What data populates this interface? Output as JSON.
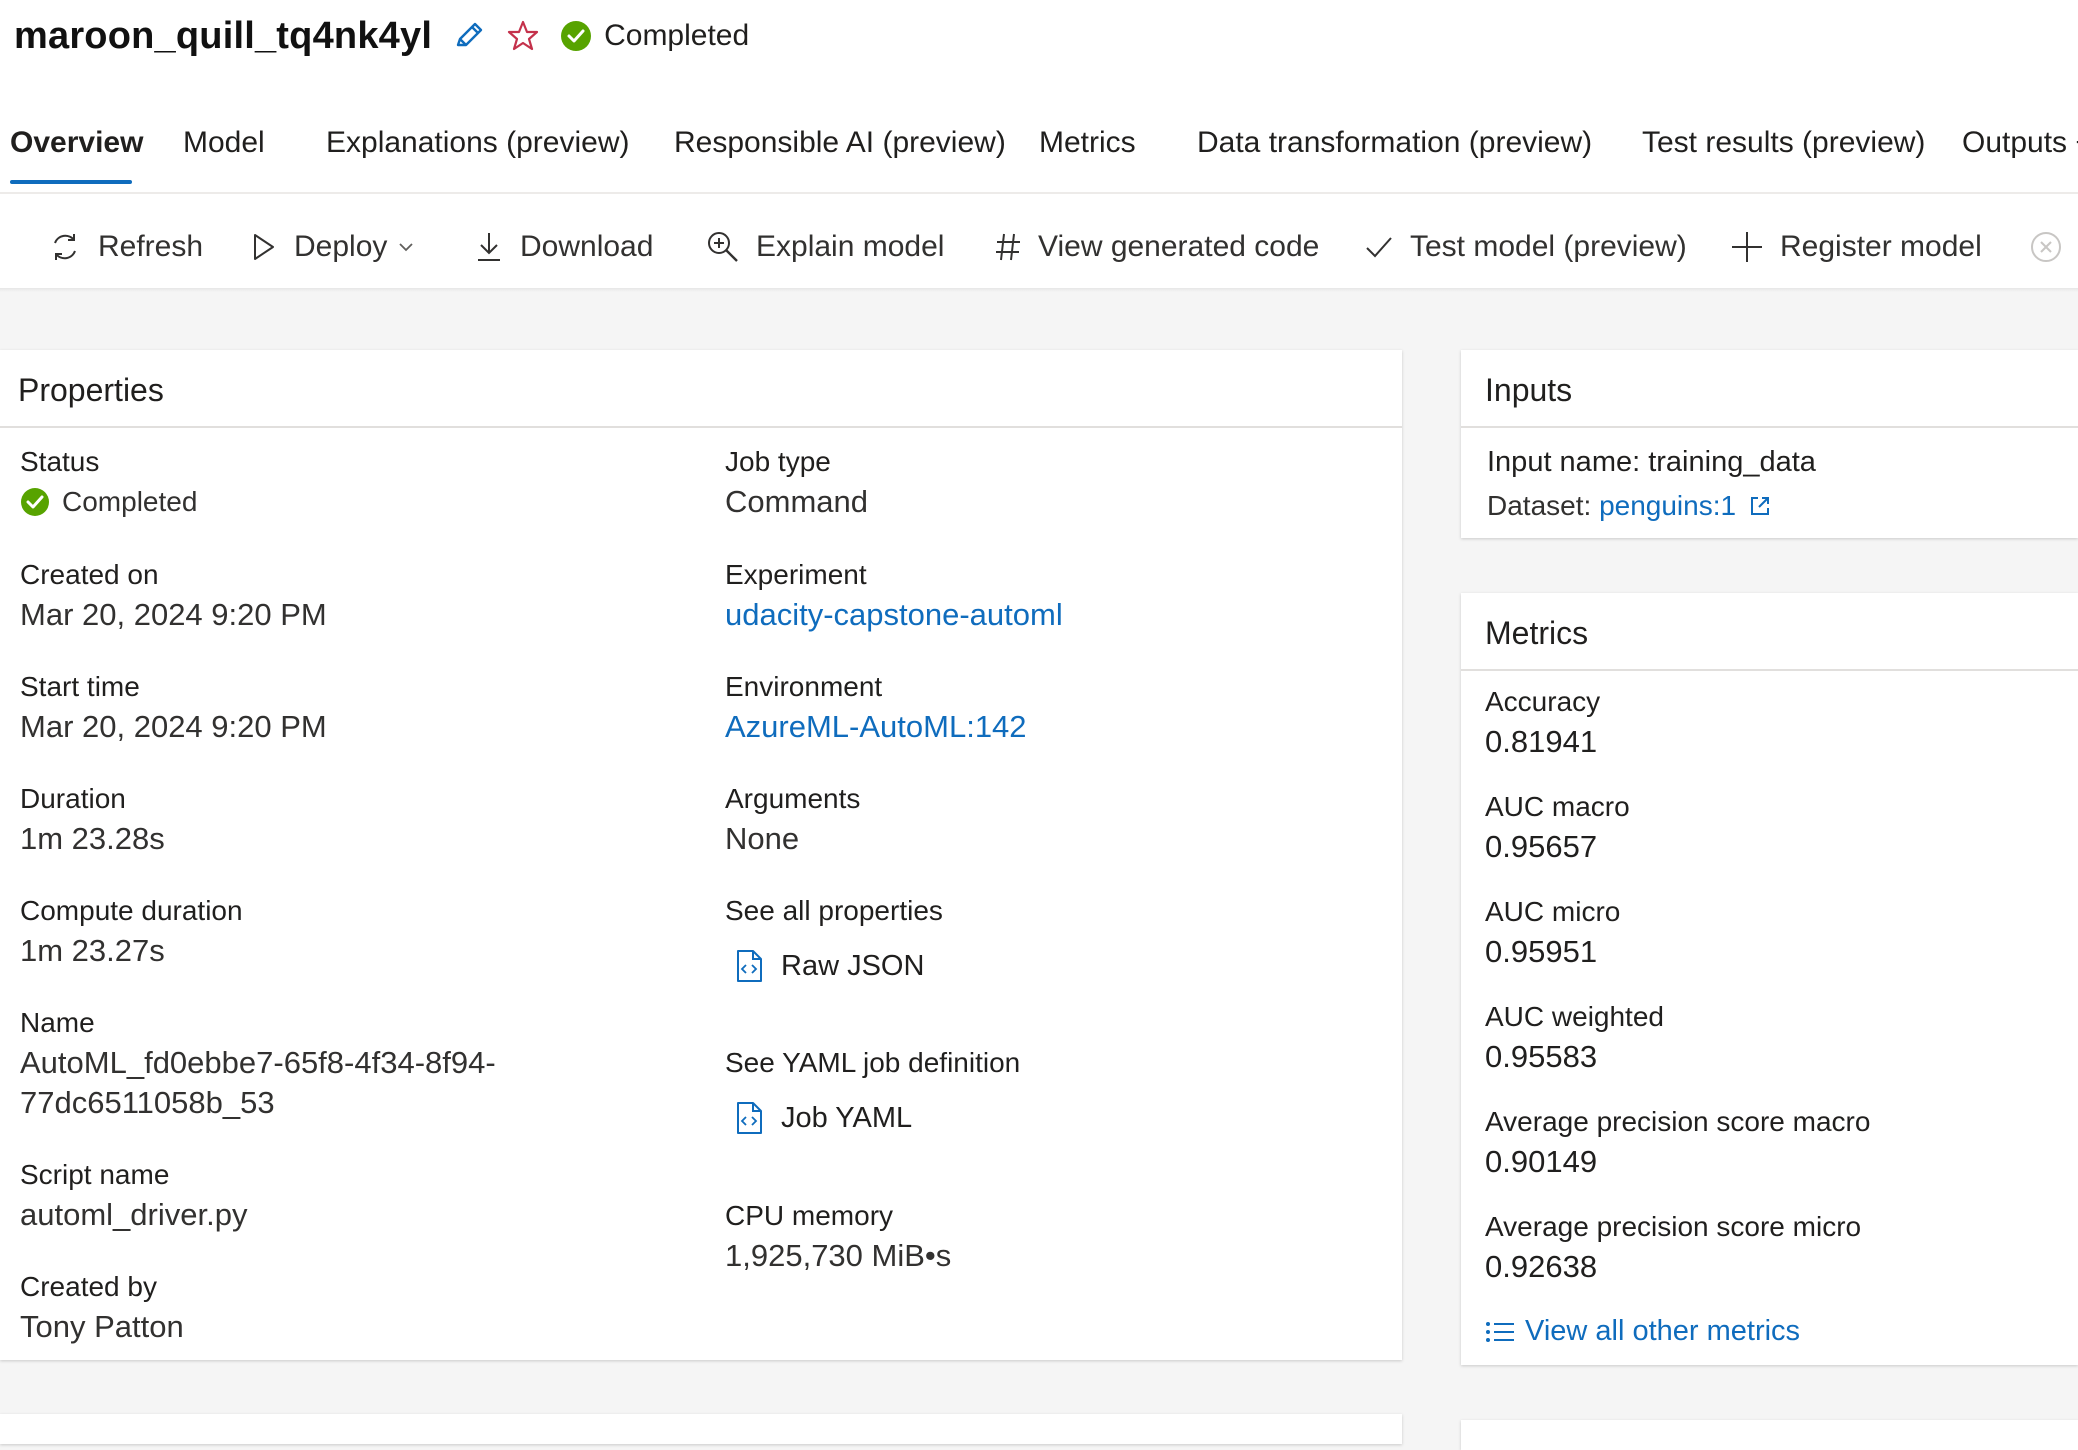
{
  "header": {
    "job_name": "maroon_quill_tq4nk4yl",
    "status": "Completed"
  },
  "tabs": [
    {
      "label": "Overview",
      "active": true
    },
    {
      "label": "Model"
    },
    {
      "label": "Explanations (preview)"
    },
    {
      "label": "Responsible AI (preview)"
    },
    {
      "label": "Metrics"
    },
    {
      "label": "Data transformation (preview)"
    },
    {
      "label": "Test results (preview)"
    },
    {
      "label": "Outputs +"
    }
  ],
  "toolbar": {
    "refresh": "Refresh",
    "deploy": "Deploy",
    "download": "Download",
    "explain": "Explain model",
    "view_code": "View generated code",
    "test_model": "Test model (preview)",
    "register": "Register model"
  },
  "properties": {
    "title": "Properties",
    "status": {
      "label": "Status",
      "value": "Completed"
    },
    "created_on": {
      "label": "Created on",
      "value": "Mar 20, 2024 9:20 PM"
    },
    "start_time": {
      "label": "Start time",
      "value": "Mar 20, 2024 9:20 PM"
    },
    "duration": {
      "label": "Duration",
      "value": "1m 23.28s"
    },
    "compute_duration": {
      "label": "Compute duration",
      "value": "1m 23.27s"
    },
    "name": {
      "label": "Name",
      "value_line1": "AutoML_fd0ebbe7-65f8-4f34-8f94-",
      "value_line2": "77dc6511058b_53"
    },
    "script_name": {
      "label": "Script name",
      "value": "automl_driver.py"
    },
    "created_by": {
      "label": "Created by",
      "value": "Tony Patton"
    },
    "job_type": {
      "label": "Job type",
      "value": "Command"
    },
    "experiment": {
      "label": "Experiment",
      "value": "udacity-capstone-automl"
    },
    "environment": {
      "label": "Environment",
      "value": "AzureML-AutoML:142"
    },
    "arguments": {
      "label": "Arguments",
      "value": "None"
    },
    "all_properties": {
      "label": "See all properties",
      "link": "Raw JSON"
    },
    "yaml": {
      "label": "See YAML job definition",
      "link": "Job YAML"
    },
    "cpu_memory": {
      "label": "CPU memory",
      "value": "1,925,730 MiB•s"
    }
  },
  "inputs": {
    "title": "Inputs",
    "input_name": "Input name: training_data",
    "dataset_label": "Dataset: ",
    "dataset_link": "penguins:1"
  },
  "metrics": {
    "title": "Metrics",
    "items": [
      {
        "label": "Accuracy",
        "value": "0.81941"
      },
      {
        "label": "AUC macro",
        "value": "0.95657"
      },
      {
        "label": "AUC micro",
        "value": "0.95951"
      },
      {
        "label": "AUC weighted",
        "value": "0.95583"
      },
      {
        "label": "Average precision score macro",
        "value": "0.90149"
      },
      {
        "label": "Average precision score micro",
        "value": "0.92638"
      }
    ],
    "view_all": "View all other metrics"
  },
  "colors": {
    "accent": "#0f6cbd",
    "success": "#57a300",
    "star": "#c4314b"
  }
}
